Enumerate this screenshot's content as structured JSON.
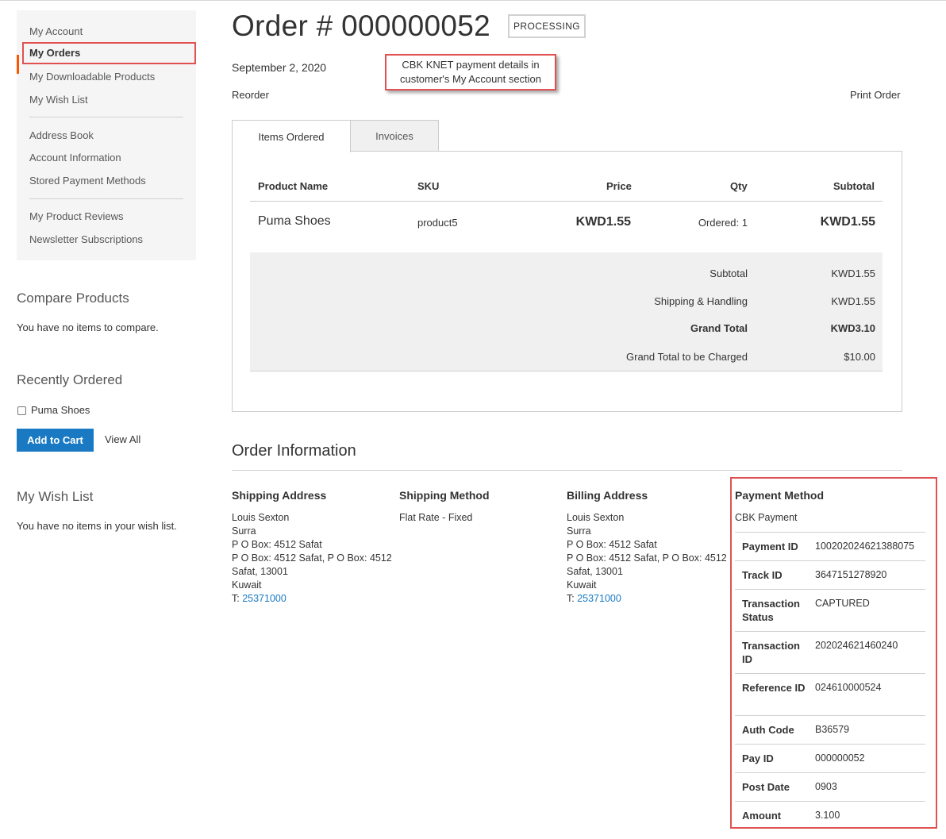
{
  "sidebar": {
    "nav": {
      "my_account": "My Account",
      "my_orders": "My Orders",
      "downloadable_products": "My Downloadable Products",
      "wish_list": "My Wish List",
      "address_book": "Address Book",
      "account_information": "Account Information",
      "stored_payment_methods": "Stored Payment Methods",
      "product_reviews": "My Product Reviews",
      "newsletter": "Newsletter Subscriptions"
    },
    "compare": {
      "title": "Compare Products",
      "empty": "You have no items to compare."
    },
    "recently_ordered": {
      "title": "Recently Ordered",
      "item": "Puma Shoes",
      "add_to_cart": "Add to Cart",
      "view_all": "View All"
    },
    "wish_list": {
      "title": "My Wish List",
      "empty": "You have no items in your wish list."
    }
  },
  "order": {
    "title": "Order # 000000052",
    "status": "PROCESSING",
    "date": "September 2, 2020",
    "reorder": "Reorder",
    "print_order": "Print Order"
  },
  "annotation": {
    "line1": "CBK KNET payment details in",
    "line2": "customer's My Account section"
  },
  "tabs": {
    "items_ordered": "Items Ordered",
    "invoices": "Invoices"
  },
  "items_table": {
    "headers": {
      "product_name": "Product Name",
      "sku": "SKU",
      "price": "Price",
      "qty": "Qty",
      "subtotal": "Subtotal"
    },
    "rows": [
      {
        "name": "Puma Shoes",
        "sku": "product5",
        "price": "KWD1.55",
        "qty": "Ordered: 1",
        "subtotal": "KWD1.55"
      }
    ],
    "totals": [
      {
        "label": "Subtotal",
        "value": "KWD1.55"
      },
      {
        "label": "Shipping & Handling",
        "value": "KWD1.55"
      },
      {
        "label": "Grand Total",
        "value": "KWD3.10"
      },
      {
        "label": "Grand Total to be Charged",
        "value": "$10.00"
      }
    ]
  },
  "order_info": {
    "title": "Order Information",
    "shipping_address": {
      "title": "Shipping Address",
      "lines": [
        "Louis Sexton",
        "Surra",
        "P O Box: 4512 Safat",
        "P O Box: 4512 Safat, P O Box: 4512",
        "Safat, 13001",
        "Kuwait"
      ],
      "phone_prefix": "T: ",
      "phone": "25371000"
    },
    "shipping_method": {
      "title": "Shipping Method",
      "value": "Flat Rate - Fixed"
    },
    "billing_address": {
      "title": "Billing Address",
      "lines": [
        "Louis Sexton",
        "Surra",
        "P O Box: 4512 Safat",
        "P O Box: 4512 Safat, P O Box: 4512",
        "Safat, 13001",
        "Kuwait"
      ],
      "phone_prefix": "T: ",
      "phone": "25371000"
    },
    "payment_method": {
      "title": "Payment Method",
      "name": "CBK Payment",
      "rows": [
        {
          "label": "Payment ID",
          "value": "100202024621388075"
        },
        {
          "label": "Track ID",
          "value": "3647151278920"
        },
        {
          "label": "Transaction Status",
          "value": "CAPTURED"
        },
        {
          "label": "Transaction ID",
          "value": "202024621460240"
        },
        {
          "label": "Reference ID",
          "value": "024610000524"
        },
        {
          "label": "Auth Code",
          "value": "B36579"
        },
        {
          "label": "Pay ID",
          "value": "000000052"
        },
        {
          "label": "Post Date",
          "value": "0903"
        },
        {
          "label": "Amount",
          "value": "3.100"
        }
      ]
    }
  },
  "colors": {
    "link": "#1979c3",
    "primary_button": "#1979c3",
    "nav_active_marker": "#ff5501",
    "highlight_border": "#e05252"
  }
}
